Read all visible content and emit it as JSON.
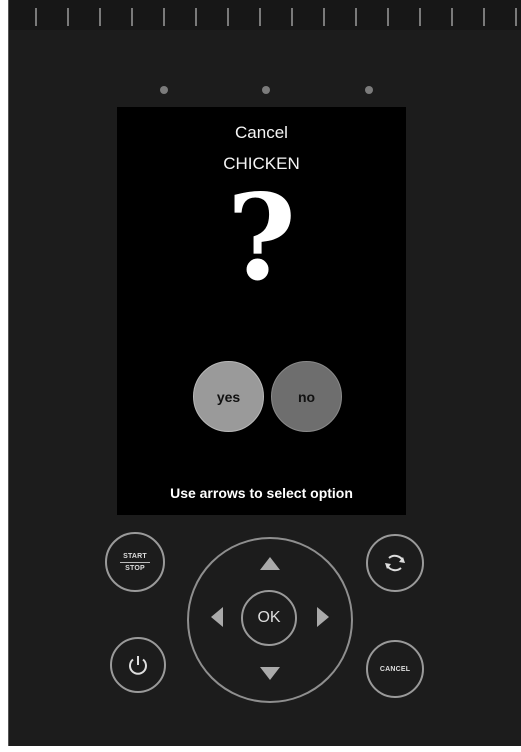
{
  "screen": {
    "title_line1": "Cancel",
    "title_line2": "CHICKEN",
    "question_glyph": "?",
    "options": [
      {
        "label": "yes",
        "selected": true
      },
      {
        "label": "no",
        "selected": false
      }
    ],
    "hint": "Use arrows to select option"
  },
  "controls": {
    "start_stop_top": "START",
    "start_stop_bottom": "STOP",
    "ok_label": "OK",
    "cancel_label": "CANCEL",
    "icons": [
      "power-icon",
      "refresh-icon",
      "arrow-up-icon",
      "arrow-down-icon",
      "arrow-left-icon",
      "arrow-right-icon"
    ]
  },
  "colors": {
    "panel": "#1c1c1c",
    "screen": "#000000",
    "yes_button": "#9a9a9a",
    "no_button": "#6e6e6e"
  }
}
